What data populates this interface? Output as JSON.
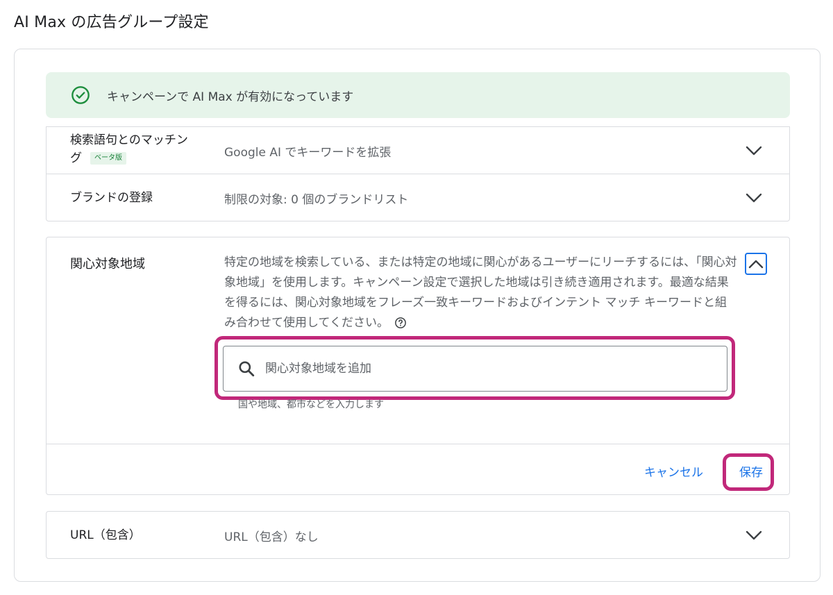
{
  "page": {
    "title": "AI Max の広告グループ設定"
  },
  "banner": {
    "text": "キャンペーンで AI Max が有効になっています",
    "icon": "check-circle-icon",
    "color": "#1e8e3e"
  },
  "settings": {
    "search_term_matching": {
      "label_line1": "検索語句とのマッチン",
      "label_line2": "グ",
      "badge": "ベータ版",
      "value": "Google AI でキーワードを拡張"
    },
    "brand_inclusion": {
      "label": "ブランドの登録",
      "value": "制限の対象: 0 個のブランドリスト"
    },
    "locations_of_interest": {
      "label": "関心対象地域",
      "description": "特定の地域を検索している、または特定の地域に関心があるユーザーにリーチするには、「関心対象地域」を使用します。キャンペーン設定で選択した地域は引き続き適用されます。最適な結果を得るには、関心対象地域をフレーズ一致キーワードおよびインテント マッチ キーワードと組み合わせて使用してください。",
      "search_placeholder": "関心対象地域を追加",
      "hint": "国や地域、都市などを入力します",
      "cancel_label": "キャンセル",
      "save_label": "保存"
    },
    "url_inclusion": {
      "label": "URL（包含）",
      "value": "URL（包含）なし"
    }
  },
  "colors": {
    "accent": "#1a73e8",
    "highlight": "#c1287a",
    "banner_bg": "#e6f4ea"
  }
}
